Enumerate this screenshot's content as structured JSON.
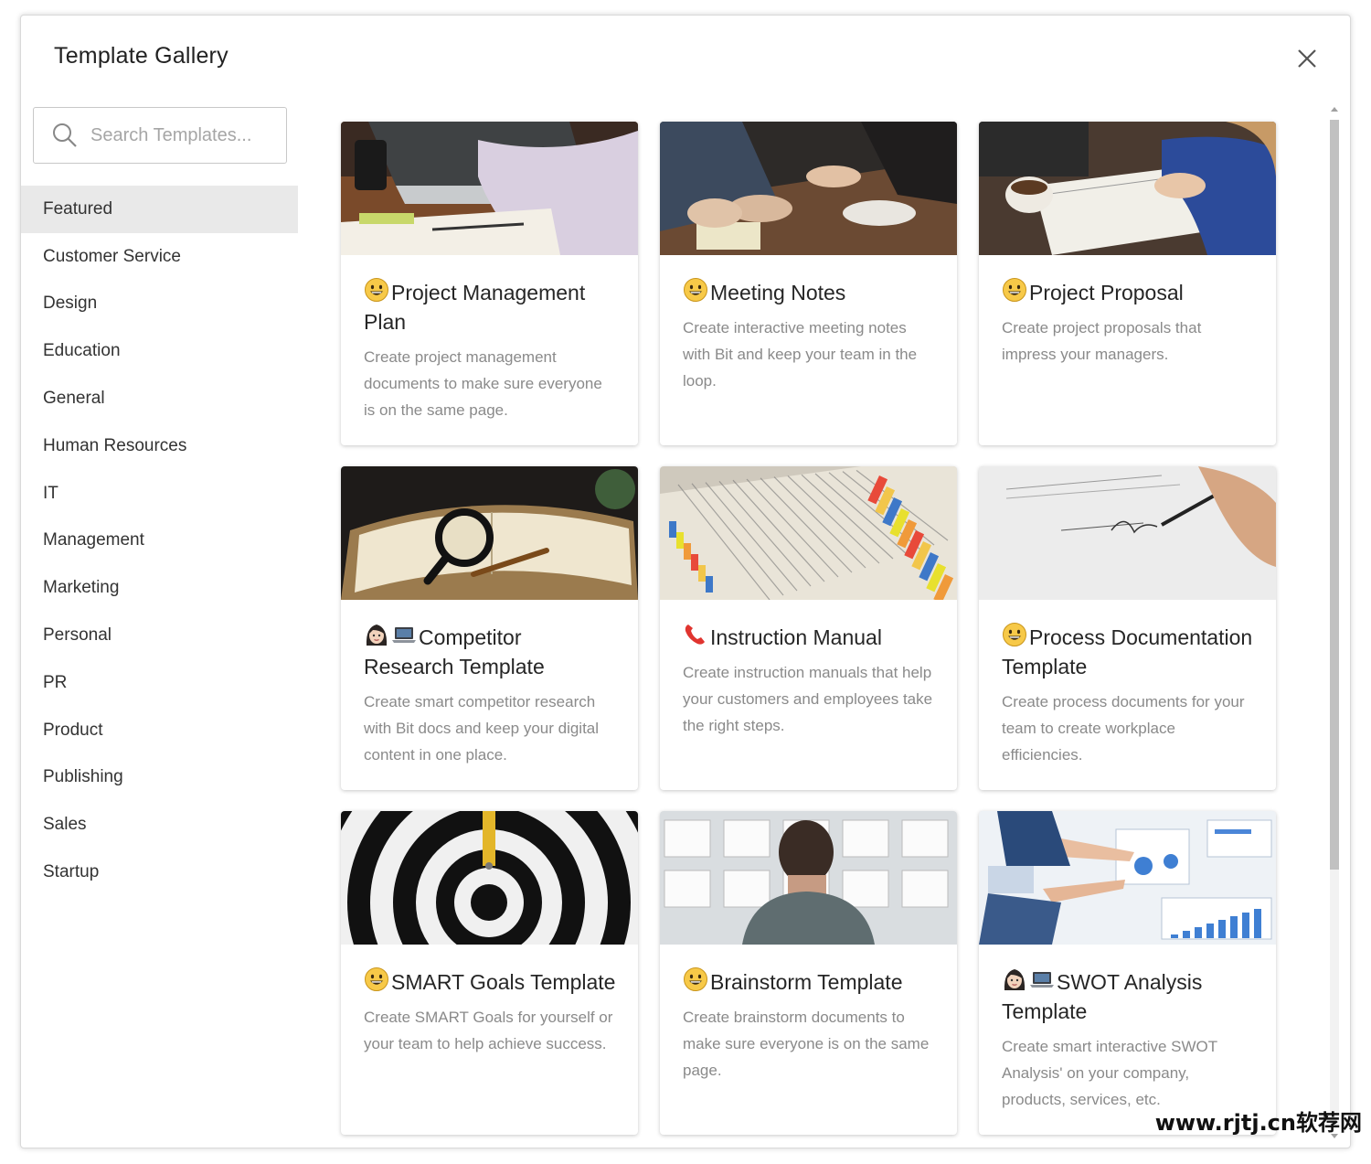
{
  "header": {
    "title": "Template Gallery"
  },
  "search": {
    "placeholder": "Search Templates..."
  },
  "sidebar": {
    "items": [
      {
        "label": "Featured",
        "active": true
      },
      {
        "label": "Customer Service"
      },
      {
        "label": "Design"
      },
      {
        "label": "Education"
      },
      {
        "label": "General"
      },
      {
        "label": "Human Resources"
      },
      {
        "label": "IT"
      },
      {
        "label": "Management"
      },
      {
        "label": "Marketing"
      },
      {
        "label": "Personal"
      },
      {
        "label": "PR"
      },
      {
        "label": "Product"
      },
      {
        "label": "Publishing"
      },
      {
        "label": "Sales"
      },
      {
        "label": "Startup"
      }
    ]
  },
  "templates": [
    {
      "icons": [
        "grinning-face-icon"
      ],
      "title": "Project Management Plan",
      "description": "Create project management documents to make sure everyone is on the same page.",
      "image": "laptop-desk-photo"
    },
    {
      "icons": [
        "grinning-face-icon"
      ],
      "title": "Meeting Notes",
      "description": "Create interactive meeting notes with Bit and keep your team in the loop.",
      "image": "meeting-table-photo"
    },
    {
      "icons": [
        "grinning-face-icon"
      ],
      "title": "Project Proposal",
      "description": "Create project proposals that impress your managers.",
      "image": "notebook-coffee-photo"
    },
    {
      "icons": [
        "woman-face-icon",
        "laptop-icon"
      ],
      "title": "Competitor Research Template",
      "description": "Create smart competitor research with Bit docs and keep your digital content in one place.",
      "image": "magnifier-book-photo"
    },
    {
      "icons": [
        "telephone-receiver-icon"
      ],
      "title": "Instruction Manual",
      "description": "Create instruction manuals that help your customers and employees take the right steps.",
      "image": "tabbed-manual-photo"
    },
    {
      "icons": [
        "grinning-face-icon"
      ],
      "title": "Process Documentation Template",
      "description": "Create process documents for your team to create workplace efficiencies.",
      "image": "signing-document-photo"
    },
    {
      "icons": [
        "grinning-face-icon"
      ],
      "title": "SMART Goals Template",
      "description": "Create SMART Goals for yourself or your team to help achieve success.",
      "image": "dartboard-photo"
    },
    {
      "icons": [
        "grinning-face-icon"
      ],
      "title": "Brainstorm Template",
      "description": "Create brainstorm documents to make sure everyone is on the same page.",
      "image": "whiteboard-wall-photo"
    },
    {
      "icons": [
        "woman-face-icon",
        "laptop-icon"
      ],
      "title": "SWOT Analysis Template",
      "description": "Create smart interactive SWOT Analysis' on your company, products, services, etc.",
      "image": "charts-pointing-photo"
    }
  ],
  "watermark": "www.rjtj.cn软荐网",
  "colors": {
    "active_bg": "#e9e9e9",
    "text": "#262626",
    "desc": "#8a8a8a",
    "emoji": "#f7c948"
  }
}
